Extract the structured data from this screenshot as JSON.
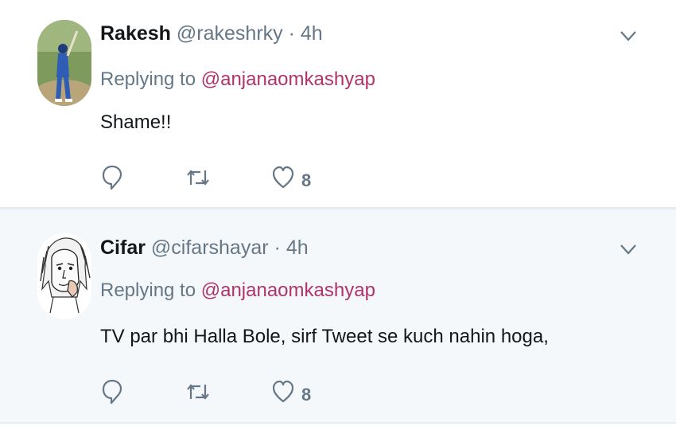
{
  "tweets": [
    {
      "name": "Rakesh",
      "handle": "@rakeshrky",
      "separator": "·",
      "time": "4h",
      "replying_label": "Replying to",
      "mention": "@anjanaomkashyap",
      "text": "Shame!!",
      "likes": "8",
      "icons": [
        "reply-icon",
        "retweet-icon",
        "like-icon",
        "chevron-down-icon"
      ]
    },
    {
      "name": "Cifar",
      "handle": "@cifarshayar",
      "separator": "·",
      "time": "4h",
      "replying_label": "Replying to",
      "mention": "@anjanaomkashyap",
      "text": "TV par bhi Halla Bole, sirf Tweet se kuch nahin hoga,",
      "likes": "8",
      "icons": [
        "reply-icon",
        "retweet-icon",
        "like-icon",
        "chevron-down-icon"
      ]
    }
  ],
  "colors": {
    "mention": "#b0336b",
    "secondary_text": "#657786",
    "highlight_background": "#f5f8fa"
  }
}
